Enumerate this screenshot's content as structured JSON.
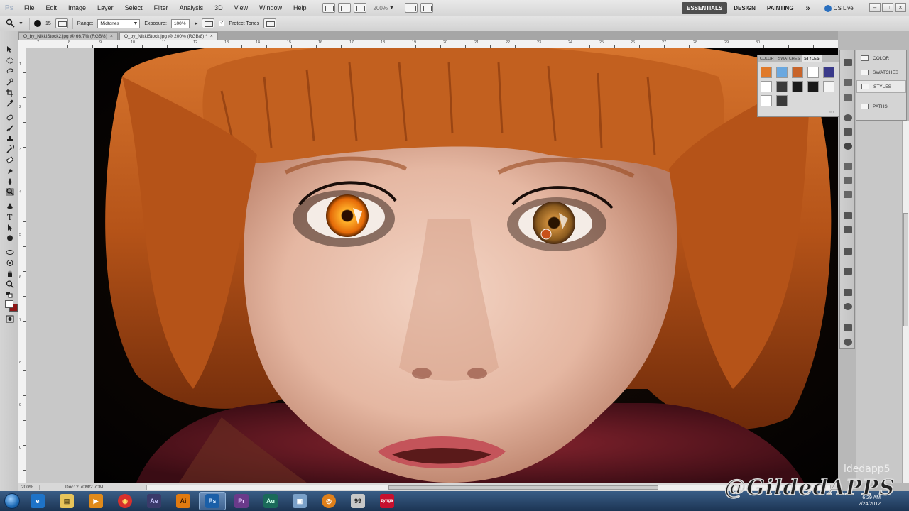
{
  "app": {
    "logo": "Ps",
    "menus": [
      "File",
      "Edit",
      "Image",
      "Layer",
      "Select",
      "Filter",
      "Analysis",
      "3D",
      "View",
      "Window",
      "Help"
    ],
    "zoom": "200%",
    "workspaces": [
      "ESSENTIALS",
      "DESIGN",
      "PAINTING"
    ],
    "workspace_more": "»",
    "cs_live": "CS Live",
    "window_controls": [
      "–",
      "□",
      "×"
    ]
  },
  "options": {
    "brush_size": "15",
    "range_label": "Range:",
    "range_value": "Midtones",
    "exposure_label": "Exposure:",
    "exposure_value": "100%",
    "protect_tones": "Protect Tones"
  },
  "tabs": [
    {
      "title": "O_by_NikkiStock2.jpg @ 66.7% (RGB/8)",
      "close": "×"
    },
    {
      "title": "O_by_NikkiStock.jpg @ 200% (RGB/8) *",
      "close": "×"
    }
  ],
  "ruler": {
    "top": [
      "7",
      "8",
      "9",
      "10",
      "11",
      "12",
      "13",
      "14",
      "15",
      "16",
      "17",
      "18",
      "19",
      "20",
      "21",
      "22",
      "23",
      "24",
      "25",
      "26",
      "27",
      "28",
      "29",
      "30"
    ],
    "left": [
      "1",
      "2",
      "3",
      "4",
      "5",
      "6",
      "7",
      "8",
      "9",
      "0"
    ]
  },
  "status": {
    "zoom": "200%",
    "doc": "Doc: 2.70M/2.70M"
  },
  "styles_panel": {
    "tabs": [
      "COLOR",
      "SWATCHES",
      "STYLES"
    ],
    "active_tab": "STYLES",
    "swatches": [
      "#e07a2a",
      "#6aa8e0",
      "#c8642a",
      "#ffffff",
      "#3a3a8a",
      "#ffffff",
      "#3a3a3a",
      "#1a1a1a",
      "#1a1a1a",
      "#f5f5f5",
      "#ffffff",
      "#3a3a3a"
    ]
  },
  "dock_panels": [
    "COLOR",
    "SWATCHES",
    "STYLES",
    "PATHS"
  ],
  "dock_active": "STYLES",
  "taskbar": {
    "apps": [
      {
        "name": "internet-explorer",
        "label": "e",
        "color": "#1e73c8"
      },
      {
        "name": "explorer",
        "label": "▤",
        "color": "#e7c45a"
      },
      {
        "name": "media-player",
        "label": "▶",
        "color": "#e08a1a"
      },
      {
        "name": "chrome",
        "label": "◉",
        "color": "#d9302c"
      },
      {
        "name": "after-effects",
        "label": "Ae",
        "color": "#3a3a6a"
      },
      {
        "name": "illustrator",
        "label": "Ai",
        "color": "#e07a10"
      },
      {
        "name": "photoshop",
        "label": "Ps",
        "color": "#1a5fa8"
      },
      {
        "name": "premiere",
        "label": "Pr",
        "color": "#6a3a8a"
      },
      {
        "name": "audition",
        "label": "Au",
        "color": "#1a6a5a"
      },
      {
        "name": "save-app",
        "label": "▣",
        "color": "#7aa0c8"
      },
      {
        "name": "blender",
        "label": "◎",
        "color": "#e0801a"
      },
      {
        "name": "plugin-app",
        "label": "99",
        "color": "#c8c8c8"
      },
      {
        "name": "zynga",
        "label": "zynga",
        "color": "#c8102e"
      }
    ],
    "time": "6:29 AM",
    "date": "2/24/2012"
  },
  "watermark": "@GildedAPPS",
  "watermark_small": "ldedapp5"
}
